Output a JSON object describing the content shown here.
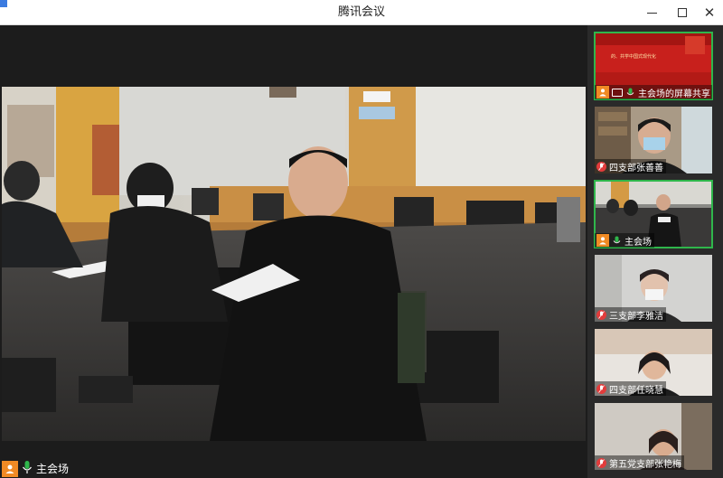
{
  "window": {
    "title": "腾讯会议",
    "controls": [
      "minimize-icon",
      "maximize-icon",
      "close-icon"
    ]
  },
  "main_video": {
    "speaker_label": "主会场",
    "mic_status": "mic-on",
    "user_icon": "user-icon"
  },
  "sidebar": {
    "tiles": [
      {
        "label": "主会场的屏幕共享",
        "type": "screen-share",
        "slide_text": "的、共学中国式现代化"
      },
      {
        "label": "四支部张善善",
        "mic_status": "mic-muted"
      },
      {
        "label": "主会场",
        "mic_status": "mic-on",
        "active": true
      },
      {
        "label": "三支部李雅洁",
        "mic_status": "mic-muted"
      },
      {
        "label": "四支部任晓慧",
        "mic_status": "mic-muted"
      },
      {
        "label": "第五党支部张艳梅",
        "mic_status": "mic-muted"
      }
    ]
  },
  "colors": {
    "accent_green": "#2fb64b",
    "user_chip_orange": "#f08a24",
    "muted_red": "#e23b3b",
    "slide_red": "#c8201c"
  }
}
